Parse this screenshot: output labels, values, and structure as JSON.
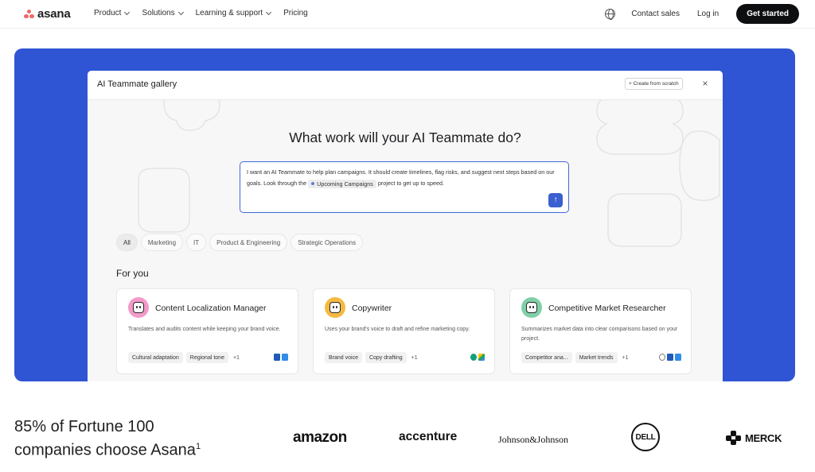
{
  "nav": {
    "logo": "asana",
    "items": [
      {
        "label": "Product",
        "dropdown": true
      },
      {
        "label": "Solutions",
        "dropdown": true
      },
      {
        "label": "Learning & support",
        "dropdown": true
      },
      {
        "label": "Pricing",
        "dropdown": false
      }
    ],
    "globe_icon": "globe-icon",
    "contact_sales": "Contact sales",
    "login": "Log in",
    "get_started": "Get started"
  },
  "modal": {
    "title": "AI Teammate gallery",
    "create_button": "+ Create from scratch",
    "close": "×",
    "question": "What work will your AI Teammate do?",
    "prompt": {
      "text_before": "I want an AI Teammate to help plan campaigns. It should create timelines, flag risks, and suggest next steps based on our goals. Look through the",
      "project_chip": "Upcoming Campaigns",
      "text_after": "project to get up to speed."
    },
    "send_icon": "arrow-up-icon",
    "filters": [
      "All",
      "Marketing",
      "IT",
      "Product & Engineering",
      "Strategic Operations"
    ],
    "active_filter": "All",
    "section_title": "For you",
    "cards": [
      {
        "title": "Content Localization Manager",
        "description": "Translates and audits content while keeping your brand voice.",
        "tags": [
          "Cultural adaptation",
          "Regional tone"
        ],
        "more": "+1",
        "icon_color": "#f49ac8"
      },
      {
        "title": "Copywriter",
        "description": "Uses your brand's voice to draft and refine marketing copy.",
        "tags": [
          "Brand voice",
          "Copy drafting"
        ],
        "more": "+1",
        "icon_color": "#f5b942"
      },
      {
        "title": "Competitive Market Researcher",
        "description": "Summarizes market data into clear comparisons based on your project.",
        "tags": [
          "Competitor ana...",
          "Market trends"
        ],
        "more": "+1",
        "icon_color": "#7fd0a8"
      }
    ]
  },
  "social_proof": {
    "headline_line1": "85% of Fortune 100",
    "headline_line2": "companies choose Asana",
    "footnote": "1",
    "logos": [
      "amazon",
      "accenture",
      "Johnson&Johnson",
      "DELL",
      "MERCK"
    ]
  },
  "colors": {
    "hero_bg": "#2f55d4",
    "brand_coral": "#f06a6a",
    "accent_blue": "#3b5fcf"
  }
}
